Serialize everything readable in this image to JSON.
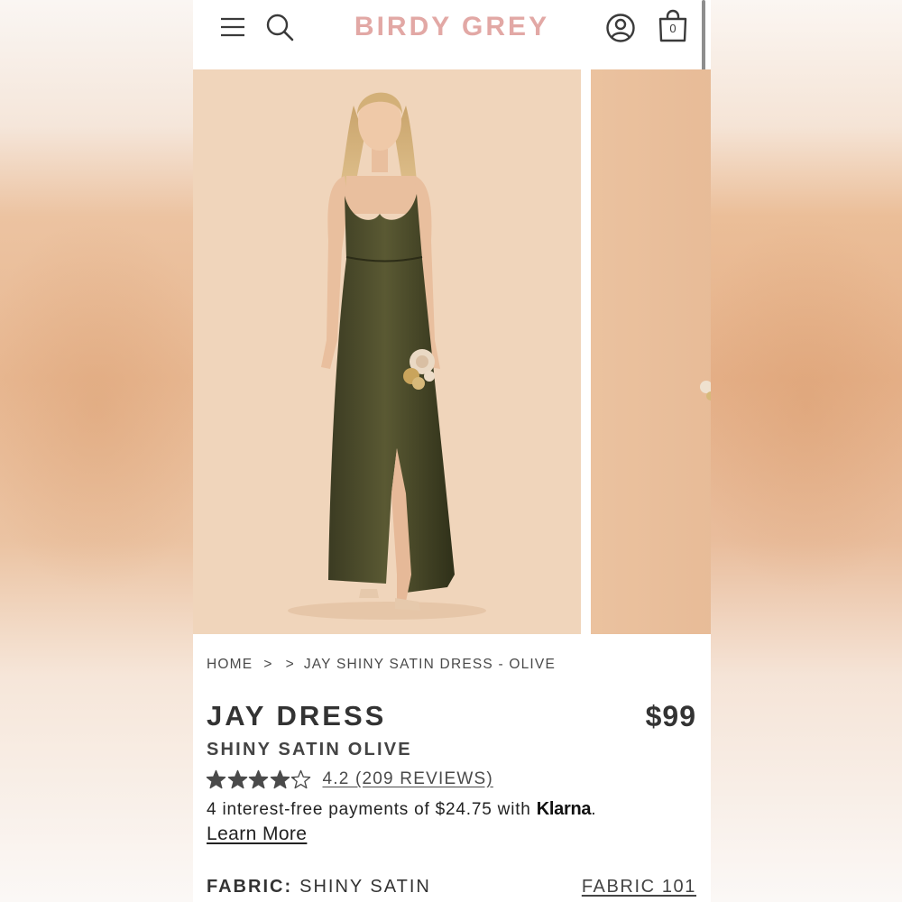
{
  "header": {
    "logo": "BIRDY GREY",
    "cart_count": "0",
    "icons": [
      "menu-icon",
      "search-icon",
      "account-icon",
      "shopping-bag-icon"
    ],
    "logo_color": "#e2a8a5"
  },
  "gallery": {
    "images": [
      "dress-model-photo",
      "dress-model-photo-next"
    ],
    "background_color": "#f0d5bb",
    "dress_color": "#4a4a2c"
  },
  "breadcrumb": {
    "home": "HOME",
    "separator": ">",
    "current": "JAY SHINY SATIN DRESS - OLIVE"
  },
  "product": {
    "name": "JAY DRESS",
    "price": "$99",
    "subtitle": "SHINY SATIN OLIVE",
    "rating_value": 4.2,
    "rating_max": 5,
    "reviews_text": "4.2 (209 REVIEWS)",
    "payment_text": "4 interest-free payments of $24.75 with ",
    "payment_provider": "Klarna",
    "payment_end": ".",
    "learn_more": "Learn More"
  },
  "fabric": {
    "label": "FABRIC:",
    "value": "SHINY SATIN",
    "link": "FABRIC 101"
  }
}
